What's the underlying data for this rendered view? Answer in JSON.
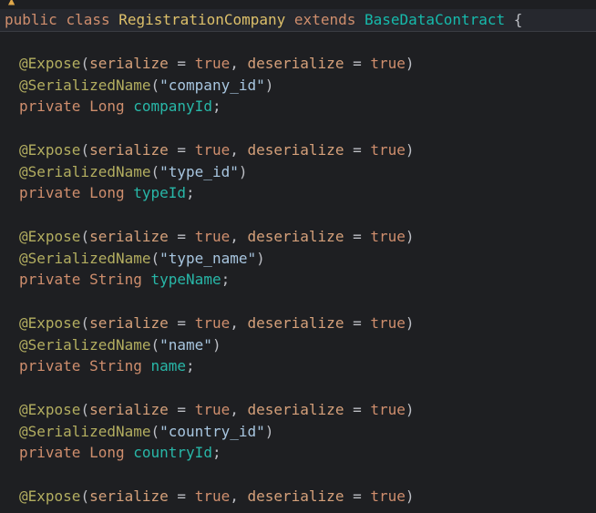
{
  "class_decl": {
    "modifier": "public",
    "keyword_class": "class",
    "class_name": "RegistrationCompany",
    "keyword_extends": "extends",
    "super_class": "BaseDataContract",
    "brace": " {"
  },
  "fields": [
    {
      "expose_anno": "@Expose",
      "expose_args_open": "(",
      "serialize_key": "serialize",
      "eq1": " = ",
      "serialize_val": "true",
      "comma": ", ",
      "deserialize_key": "deserialize",
      "eq2": " = ",
      "deserialize_val": "true",
      "expose_args_close": ")",
      "sn_anno": "@SerializedName",
      "sn_open": "(",
      "sn_value": "\"company_id\"",
      "sn_close": ")",
      "modifier": "private",
      "type": "Long",
      "name": "companyId",
      "semi": ";"
    },
    {
      "expose_anno": "@Expose",
      "expose_args_open": "(",
      "serialize_key": "serialize",
      "eq1": " = ",
      "serialize_val": "true",
      "comma": ", ",
      "deserialize_key": "deserialize",
      "eq2": " = ",
      "deserialize_val": "true",
      "expose_args_close": ")",
      "sn_anno": "@SerializedName",
      "sn_open": "(",
      "sn_value": "\"type_id\"",
      "sn_close": ")",
      "modifier": "private",
      "type": "Long",
      "name": "typeId",
      "semi": ";"
    },
    {
      "expose_anno": "@Expose",
      "expose_args_open": "(",
      "serialize_key": "serialize",
      "eq1": " = ",
      "serialize_val": "true",
      "comma": ", ",
      "deserialize_key": "deserialize",
      "eq2": " = ",
      "deserialize_val": "true",
      "expose_args_close": ")",
      "sn_anno": "@SerializedName",
      "sn_open": "(",
      "sn_value": "\"type_name\"",
      "sn_close": ")",
      "modifier": "private",
      "type": "String",
      "name": "typeName",
      "semi": ";"
    },
    {
      "expose_anno": "@Expose",
      "expose_args_open": "(",
      "serialize_key": "serialize",
      "eq1": " = ",
      "serialize_val": "true",
      "comma": ", ",
      "deserialize_key": "deserialize",
      "eq2": " = ",
      "deserialize_val": "true",
      "expose_args_close": ")",
      "sn_anno": "@SerializedName",
      "sn_open": "(",
      "sn_value": "\"name\"",
      "sn_close": ")",
      "modifier": "private",
      "type": "String",
      "name": "name",
      "semi": ";"
    },
    {
      "expose_anno": "@Expose",
      "expose_args_open": "(",
      "serialize_key": "serialize",
      "eq1": " = ",
      "serialize_val": "true",
      "comma": ", ",
      "deserialize_key": "deserialize",
      "eq2": " = ",
      "deserialize_val": "true",
      "expose_args_close": ")",
      "sn_anno": "@SerializedName",
      "sn_open": "(",
      "sn_value": "\"country_id\"",
      "sn_close": ")",
      "modifier": "private",
      "type": "Long",
      "name": "countryId",
      "semi": ";"
    },
    {
      "expose_anno": "@Expose",
      "expose_args_open": "(",
      "serialize_key": "serialize",
      "eq1": " = ",
      "serialize_val": "true",
      "comma": ", ",
      "deserialize_key": "deserialize",
      "eq2": " = ",
      "deserialize_val": "true",
      "expose_args_close": ")"
    }
  ],
  "colors": {
    "background": "#1e1f22",
    "keyword": "#cf8e6d",
    "annotation": "#b3ae60",
    "string": "#6aab73",
    "type_ref": "#16baac",
    "text": "#bcbec4"
  },
  "icons": {
    "top_marker": "bulb-icon"
  }
}
